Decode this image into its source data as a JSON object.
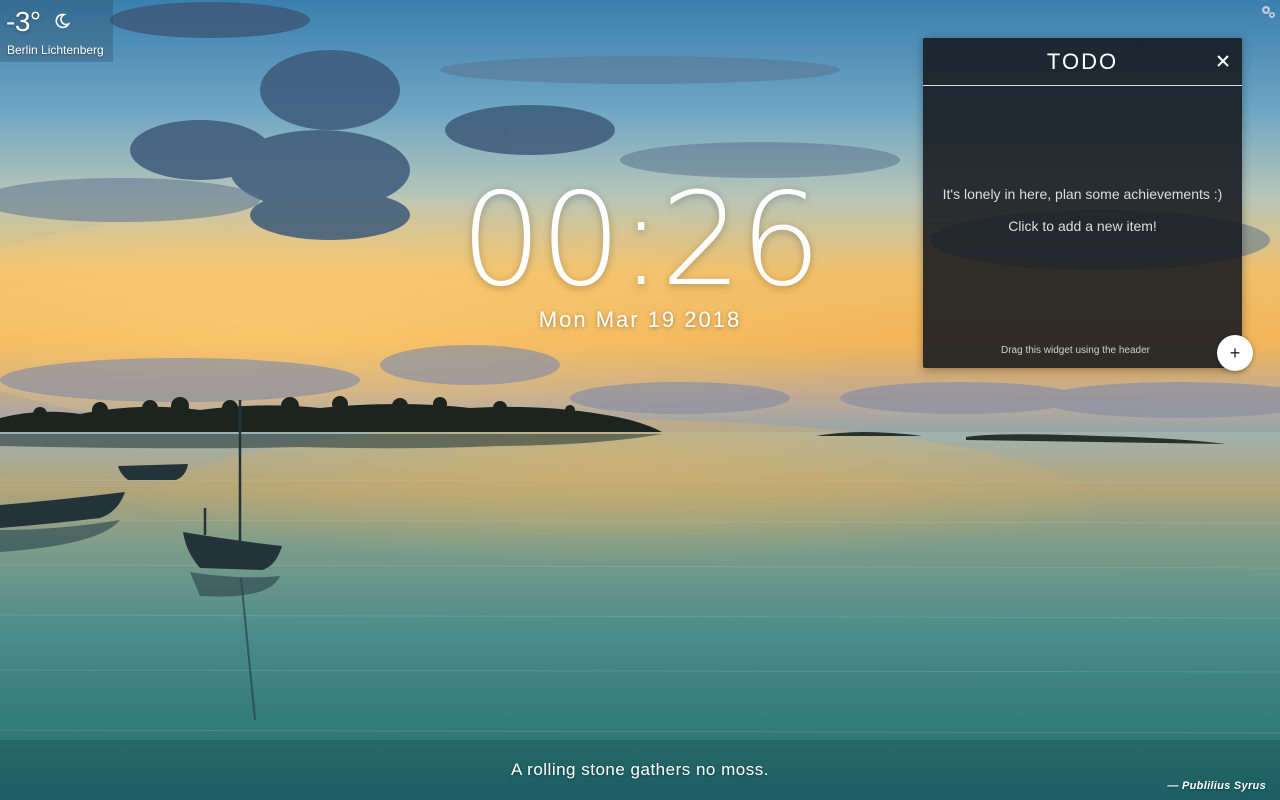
{
  "weather": {
    "temperature": "-3°",
    "location": "Berlin Lichtenberg",
    "icon": "moon-icon"
  },
  "clock": {
    "time": "00:26",
    "date": "Mon Mar 19 2018"
  },
  "todo": {
    "title": "TODO",
    "empty_line_1": "It's lonely in here, plan some achievements :)",
    "empty_line_2": "Click to add a new item!",
    "drag_hint": "Drag this widget using the header",
    "add_label": "+",
    "close_icon": "close-icon"
  },
  "quote": {
    "text": "A rolling stone gathers no moss.",
    "author": "—  Publilius Syrus"
  },
  "settings": {
    "icon": "gear-icon"
  },
  "colors": {
    "sky_top": "#3d83b0",
    "sunset": "#f0b048",
    "water": "#3f8a8a",
    "widget_bg": "#14181e"
  }
}
